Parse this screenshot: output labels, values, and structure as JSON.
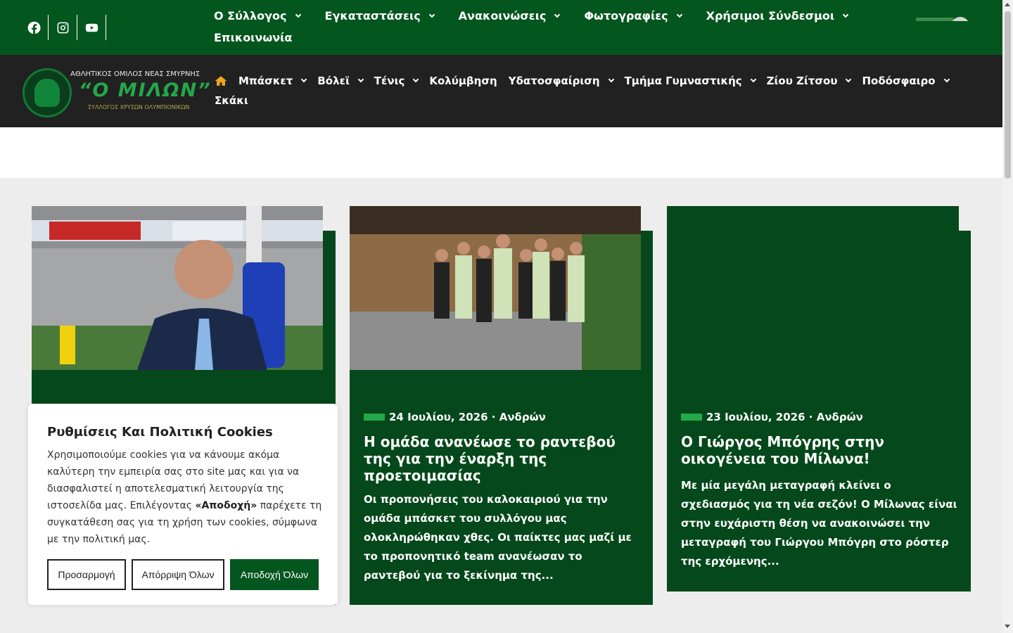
{
  "topbar": {
    "social": [
      {
        "icon": "facebook-icon"
      },
      {
        "icon": "instagram-icon"
      },
      {
        "icon": "youtube-icon"
      }
    ],
    "nav": [
      {
        "label": "Ο Σύλλογος",
        "dropdown": true
      },
      {
        "label": "Εγκαταστάσεις",
        "dropdown": true
      },
      {
        "label": "Ανακοινώσεις",
        "dropdown": true
      },
      {
        "label": "Φωτογραφίες",
        "dropdown": true
      },
      {
        "label": "Χρήσιμοι Σύνδεσμοι",
        "dropdown": true
      },
      {
        "label": "Επικοινωνία",
        "dropdown": false
      }
    ]
  },
  "logo": {
    "line1": "ΑΘΛΗΤΙΚΟΣ ΟΜΙΛΟΣ ΝΕΑΣ ΣΜΥΡΝΗΣ",
    "line2": "“Ο ΜΙΛΩΝ”",
    "line3": "ΣΥΛΛΟΓΟΣ ΧΡΥΣΩΝ ΟΛΥΜΠΙΟΝΙΚΩΝ"
  },
  "mainnav": {
    "home_icon": "home-icon",
    "items": [
      {
        "label": "Μπάσκετ",
        "dropdown": true
      },
      {
        "label": "Βόλεϊ",
        "dropdown": true
      },
      {
        "label": "Τένις",
        "dropdown": true
      },
      {
        "label": "Κολύμβηση",
        "dropdown": false
      },
      {
        "label": "Υδατοσφαίριση",
        "dropdown": true
      },
      {
        "label": "Τμήμα Γυμναστικής",
        "dropdown": true
      },
      {
        "label": "Ζίου Ζίτσου",
        "dropdown": true
      },
      {
        "label": "Ποδόσφαιρο",
        "dropdown": true
      },
      {
        "label": "Σκάκι",
        "dropdown": false
      }
    ]
  },
  "posts": [
    {
      "date": "",
      "category": "",
      "title": "",
      "excerpt": ""
    },
    {
      "date": "24 Ιουλίου, 2026",
      "category": "Ανδρών",
      "title": "Η ομάδα ανανέωσε το ραντεβού της για την έναρξη της προετοιμασίας",
      "excerpt": "Οι προπονήσεις του καλοκαιριού για την ομάδα μπάσκετ του συλλόγου μας ολοκληρώθηκαν χθες. Οι παίκτες μας μαζί με το προπονητικό team ανανέωσαν το ραντεβού για το ξεκίνημα της..."
    },
    {
      "date": "23 Ιουλίου, 2026",
      "category": "Ανδρών",
      "title": "Ο Γιώργος Μπόγρης στην οικογένεια του Μίλωνα!",
      "excerpt": "Με μία μεγάλη μεταγραφή κλείνει ο σχεδιασμός για τη νέα σεζόν! Ο Μίλωνας είναι στην ευχάριστη θέση να ανακοινώσει την μεταγραφή του Γιώργου Μπόγρη στο ρόστερ της ερχόμενης..."
    }
  ],
  "cookie": {
    "title": "Ρυθμίσεις Και Πολιτική Cookies",
    "text_a": "Χρησιμοποιούμε cookies για να κάνουμε ακόμα καλύτερη την εμπειρία σας στο site μας και για να διασφαλιστεί η αποτελεσματική λειτουργία της ιστοσελίδα μας. Επιλέγοντας ",
    "text_bold": "«Αποδοχή»",
    "text_b": " παρέχετε τη συγκατάθεση σας για τη χρήση των cookies, σύμφωνα με την πολιτική μας.",
    "customize": "Προσαρμογή",
    "reject": "Απόρριψη Όλων",
    "accept": "Αποδοχή Όλων"
  },
  "colors": {
    "primary_green": "#04561f",
    "card_green": "#04481b",
    "nav_dark": "#212121",
    "accent": "#23a84a",
    "home_icon": "#f2a51c"
  }
}
